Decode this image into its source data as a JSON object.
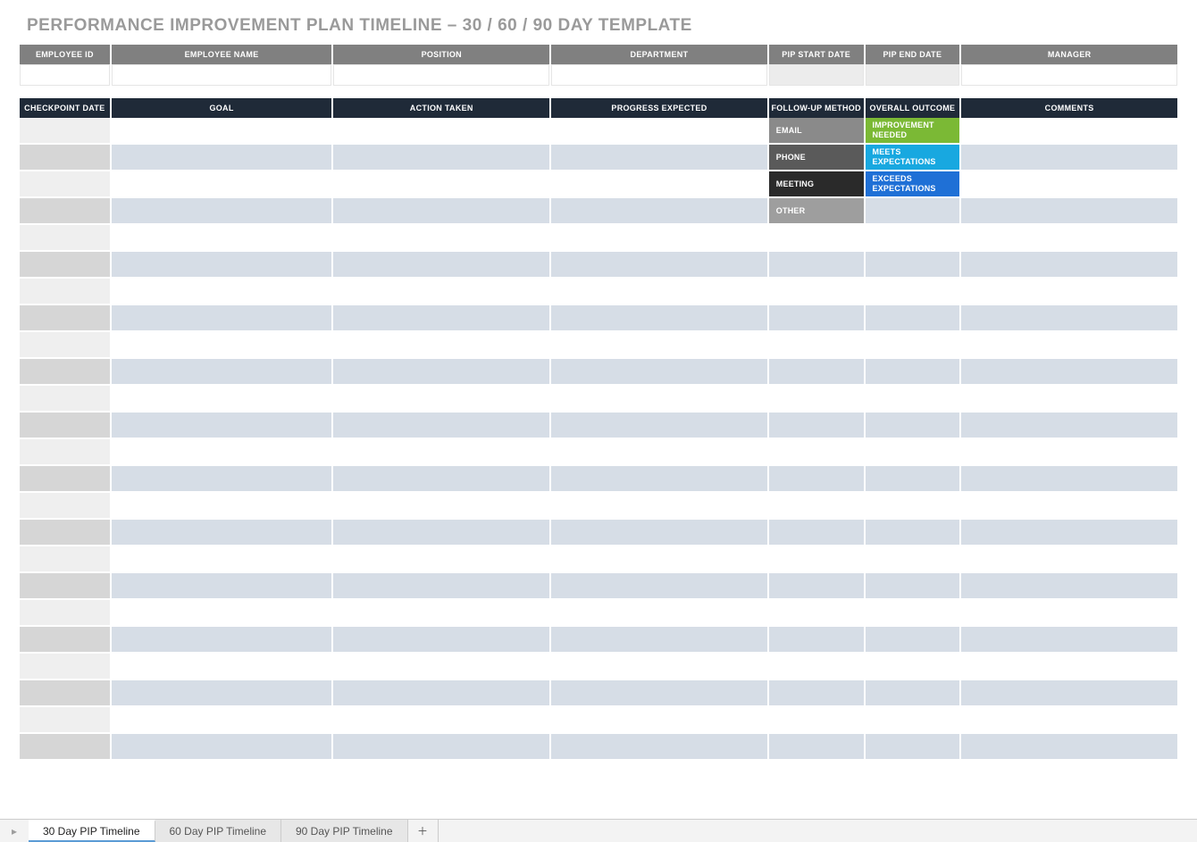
{
  "title": "PERFORMANCE IMPROVEMENT PLAN TIMELINE  –  30 / 60 / 90 DAY TEMPLATE",
  "info_headers": {
    "employee_id": "EMPLOYEE ID",
    "employee_name": "EMPLOYEE NAME",
    "position": "POSITION",
    "department": "DEPARTMENT",
    "pip_start_date": "PIP START DATE",
    "pip_end_date": "PIP END DATE",
    "manager": "MANAGER"
  },
  "info_values": {
    "employee_id": "",
    "employee_name": "",
    "position": "",
    "department": "",
    "pip_start_date": "",
    "pip_end_date": "",
    "manager": ""
  },
  "main_headers": {
    "checkpoint_date": "CHECKPOINT DATE",
    "goal": "GOAL",
    "action_taken": "ACTION TAKEN",
    "progress_expected": "PROGRESS EXPECTED",
    "follow_up_method": "FOLLOW-UP METHOD",
    "overall_outcome": "OVERALL OUTCOME",
    "comments": "COMMENTS"
  },
  "followup_options": {
    "email": "EMAIL",
    "phone": "PHONE",
    "meeting": "MEETING",
    "other": "OTHER"
  },
  "outcome_options": {
    "improvement_needed": "IMPROVEMENT NEEDED",
    "meets_expectations": "MEETS EXPECTATIONS",
    "exceeds_expectations": "EXCEEDS EXPECTATIONS"
  },
  "row_count": 24,
  "tabs": {
    "t30": "30 Day PIP Timeline",
    "t60": "60 Day PIP Timeline",
    "t90": "90 Day PIP Timeline",
    "active": "t30"
  }
}
